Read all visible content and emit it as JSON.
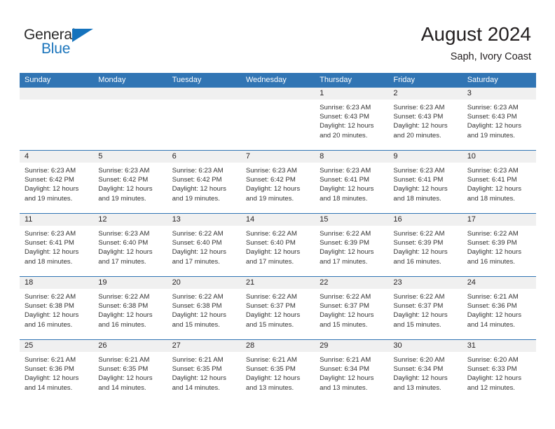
{
  "brand": {
    "name_part1": "General",
    "name_part2": "Blue",
    "flag_icon": "triangle-flag-icon",
    "colors": {
      "general_text": "#2b2b2b",
      "blue_text": "#1b75bc",
      "flag": "#1573bd"
    }
  },
  "header": {
    "title": "August 2024",
    "subtitle": "Saph, Ivory Coast"
  },
  "theme": {
    "header_blue": "#3175b4",
    "daynum_band": "#f0f0f0",
    "text": "#231f20",
    "detail_text": "#333333"
  },
  "weekdays": [
    "Sunday",
    "Monday",
    "Tuesday",
    "Wednesday",
    "Thursday",
    "Friday",
    "Saturday"
  ],
  "weeks": [
    [
      {
        "day": "",
        "sunrise": "",
        "sunset": "",
        "daylight_line1": "",
        "daylight_line2": "",
        "empty": true
      },
      {
        "day": "",
        "sunrise": "",
        "sunset": "",
        "daylight_line1": "",
        "daylight_line2": "",
        "empty": true
      },
      {
        "day": "",
        "sunrise": "",
        "sunset": "",
        "daylight_line1": "",
        "daylight_line2": "",
        "empty": true
      },
      {
        "day": "",
        "sunrise": "",
        "sunset": "",
        "daylight_line1": "",
        "daylight_line2": "",
        "empty": true
      },
      {
        "day": "1",
        "sunrise": "Sunrise: 6:23 AM",
        "sunset": "Sunset: 6:43 PM",
        "daylight_line1": "Daylight: 12 hours",
        "daylight_line2": "and 20 minutes.",
        "empty": false
      },
      {
        "day": "2",
        "sunrise": "Sunrise: 6:23 AM",
        "sunset": "Sunset: 6:43 PM",
        "daylight_line1": "Daylight: 12 hours",
        "daylight_line2": "and 20 minutes.",
        "empty": false
      },
      {
        "day": "3",
        "sunrise": "Sunrise: 6:23 AM",
        "sunset": "Sunset: 6:43 PM",
        "daylight_line1": "Daylight: 12 hours",
        "daylight_line2": "and 19 minutes.",
        "empty": false
      }
    ],
    [
      {
        "day": "4",
        "sunrise": "Sunrise: 6:23 AM",
        "sunset": "Sunset: 6:42 PM",
        "daylight_line1": "Daylight: 12 hours",
        "daylight_line2": "and 19 minutes.",
        "empty": false
      },
      {
        "day": "5",
        "sunrise": "Sunrise: 6:23 AM",
        "sunset": "Sunset: 6:42 PM",
        "daylight_line1": "Daylight: 12 hours",
        "daylight_line2": "and 19 minutes.",
        "empty": false
      },
      {
        "day": "6",
        "sunrise": "Sunrise: 6:23 AM",
        "sunset": "Sunset: 6:42 PM",
        "daylight_line1": "Daylight: 12 hours",
        "daylight_line2": "and 19 minutes.",
        "empty": false
      },
      {
        "day": "7",
        "sunrise": "Sunrise: 6:23 AM",
        "sunset": "Sunset: 6:42 PM",
        "daylight_line1": "Daylight: 12 hours",
        "daylight_line2": "and 19 minutes.",
        "empty": false
      },
      {
        "day": "8",
        "sunrise": "Sunrise: 6:23 AM",
        "sunset": "Sunset: 6:41 PM",
        "daylight_line1": "Daylight: 12 hours",
        "daylight_line2": "and 18 minutes.",
        "empty": false
      },
      {
        "day": "9",
        "sunrise": "Sunrise: 6:23 AM",
        "sunset": "Sunset: 6:41 PM",
        "daylight_line1": "Daylight: 12 hours",
        "daylight_line2": "and 18 minutes.",
        "empty": false
      },
      {
        "day": "10",
        "sunrise": "Sunrise: 6:23 AM",
        "sunset": "Sunset: 6:41 PM",
        "daylight_line1": "Daylight: 12 hours",
        "daylight_line2": "and 18 minutes.",
        "empty": false
      }
    ],
    [
      {
        "day": "11",
        "sunrise": "Sunrise: 6:23 AM",
        "sunset": "Sunset: 6:41 PM",
        "daylight_line1": "Daylight: 12 hours",
        "daylight_line2": "and 18 minutes.",
        "empty": false
      },
      {
        "day": "12",
        "sunrise": "Sunrise: 6:23 AM",
        "sunset": "Sunset: 6:40 PM",
        "daylight_line1": "Daylight: 12 hours",
        "daylight_line2": "and 17 minutes.",
        "empty": false
      },
      {
        "day": "13",
        "sunrise": "Sunrise: 6:22 AM",
        "sunset": "Sunset: 6:40 PM",
        "daylight_line1": "Daylight: 12 hours",
        "daylight_line2": "and 17 minutes.",
        "empty": false
      },
      {
        "day": "14",
        "sunrise": "Sunrise: 6:22 AM",
        "sunset": "Sunset: 6:40 PM",
        "daylight_line1": "Daylight: 12 hours",
        "daylight_line2": "and 17 minutes.",
        "empty": false
      },
      {
        "day": "15",
        "sunrise": "Sunrise: 6:22 AM",
        "sunset": "Sunset: 6:39 PM",
        "daylight_line1": "Daylight: 12 hours",
        "daylight_line2": "and 17 minutes.",
        "empty": false
      },
      {
        "day": "16",
        "sunrise": "Sunrise: 6:22 AM",
        "sunset": "Sunset: 6:39 PM",
        "daylight_line1": "Daylight: 12 hours",
        "daylight_line2": "and 16 minutes.",
        "empty": false
      },
      {
        "day": "17",
        "sunrise": "Sunrise: 6:22 AM",
        "sunset": "Sunset: 6:39 PM",
        "daylight_line1": "Daylight: 12 hours",
        "daylight_line2": "and 16 minutes.",
        "empty": false
      }
    ],
    [
      {
        "day": "18",
        "sunrise": "Sunrise: 6:22 AM",
        "sunset": "Sunset: 6:38 PM",
        "daylight_line1": "Daylight: 12 hours",
        "daylight_line2": "and 16 minutes.",
        "empty": false
      },
      {
        "day": "19",
        "sunrise": "Sunrise: 6:22 AM",
        "sunset": "Sunset: 6:38 PM",
        "daylight_line1": "Daylight: 12 hours",
        "daylight_line2": "and 16 minutes.",
        "empty": false
      },
      {
        "day": "20",
        "sunrise": "Sunrise: 6:22 AM",
        "sunset": "Sunset: 6:38 PM",
        "daylight_line1": "Daylight: 12 hours",
        "daylight_line2": "and 15 minutes.",
        "empty": false
      },
      {
        "day": "21",
        "sunrise": "Sunrise: 6:22 AM",
        "sunset": "Sunset: 6:37 PM",
        "daylight_line1": "Daylight: 12 hours",
        "daylight_line2": "and 15 minutes.",
        "empty": false
      },
      {
        "day": "22",
        "sunrise": "Sunrise: 6:22 AM",
        "sunset": "Sunset: 6:37 PM",
        "daylight_line1": "Daylight: 12 hours",
        "daylight_line2": "and 15 minutes.",
        "empty": false
      },
      {
        "day": "23",
        "sunrise": "Sunrise: 6:22 AM",
        "sunset": "Sunset: 6:37 PM",
        "daylight_line1": "Daylight: 12 hours",
        "daylight_line2": "and 15 minutes.",
        "empty": false
      },
      {
        "day": "24",
        "sunrise": "Sunrise: 6:21 AM",
        "sunset": "Sunset: 6:36 PM",
        "daylight_line1": "Daylight: 12 hours",
        "daylight_line2": "and 14 minutes.",
        "empty": false
      }
    ],
    [
      {
        "day": "25",
        "sunrise": "Sunrise: 6:21 AM",
        "sunset": "Sunset: 6:36 PM",
        "daylight_line1": "Daylight: 12 hours",
        "daylight_line2": "and 14 minutes.",
        "empty": false
      },
      {
        "day": "26",
        "sunrise": "Sunrise: 6:21 AM",
        "sunset": "Sunset: 6:35 PM",
        "daylight_line1": "Daylight: 12 hours",
        "daylight_line2": "and 14 minutes.",
        "empty": false
      },
      {
        "day": "27",
        "sunrise": "Sunrise: 6:21 AM",
        "sunset": "Sunset: 6:35 PM",
        "daylight_line1": "Daylight: 12 hours",
        "daylight_line2": "and 14 minutes.",
        "empty": false
      },
      {
        "day": "28",
        "sunrise": "Sunrise: 6:21 AM",
        "sunset": "Sunset: 6:35 PM",
        "daylight_line1": "Daylight: 12 hours",
        "daylight_line2": "and 13 minutes.",
        "empty": false
      },
      {
        "day": "29",
        "sunrise": "Sunrise: 6:21 AM",
        "sunset": "Sunset: 6:34 PM",
        "daylight_line1": "Daylight: 12 hours",
        "daylight_line2": "and 13 minutes.",
        "empty": false
      },
      {
        "day": "30",
        "sunrise": "Sunrise: 6:20 AM",
        "sunset": "Sunset: 6:34 PM",
        "daylight_line1": "Daylight: 12 hours",
        "daylight_line2": "and 13 minutes.",
        "empty": false
      },
      {
        "day": "31",
        "sunrise": "Sunrise: 6:20 AM",
        "sunset": "Sunset: 6:33 PM",
        "daylight_line1": "Daylight: 12 hours",
        "daylight_line2": "and 12 minutes.",
        "empty": false
      }
    ]
  ]
}
